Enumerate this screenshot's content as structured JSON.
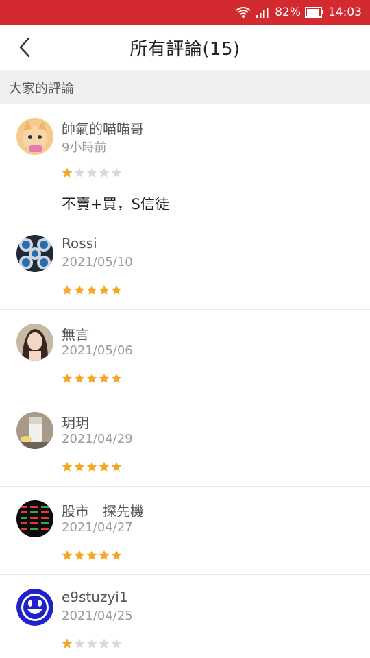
{
  "status": {
    "battery_pct": "82%",
    "time": "14:03"
  },
  "header": {
    "title": "所有評論(15)"
  },
  "section": {
    "label": "大家的評論"
  },
  "colors": {
    "accent": "#d32a2f",
    "star_on": "#f5a623",
    "star_off": "#d9d9d9"
  },
  "reviews": [
    {
      "name": "帥氣的喵喵哥",
      "date": "9小時前",
      "rating": 1,
      "comment": "不賣+買，S信徒",
      "avatar_icon": "cat-photo-avatar"
    },
    {
      "name": "Rossi",
      "date": "2021/05/10",
      "rating": 5,
      "comment": "",
      "avatar_icon": "bmw-logos-avatar"
    },
    {
      "name": "無言",
      "date": "2021/05/06",
      "rating": 5,
      "comment": "",
      "avatar_icon": "portrait-photo-avatar"
    },
    {
      "name": "玥玥",
      "date": "2021/04/29",
      "rating": 5,
      "comment": "",
      "avatar_icon": "drink-photo-avatar"
    },
    {
      "name": "股市　探先機",
      "date": "2021/04/27",
      "rating": 5,
      "comment": "",
      "avatar_icon": "stock-board-avatar"
    },
    {
      "name": "e9stuzyi1",
      "date": "2021/04/25",
      "rating": 1,
      "comment": "",
      "avatar_icon": "smiley-face-avatar"
    }
  ]
}
